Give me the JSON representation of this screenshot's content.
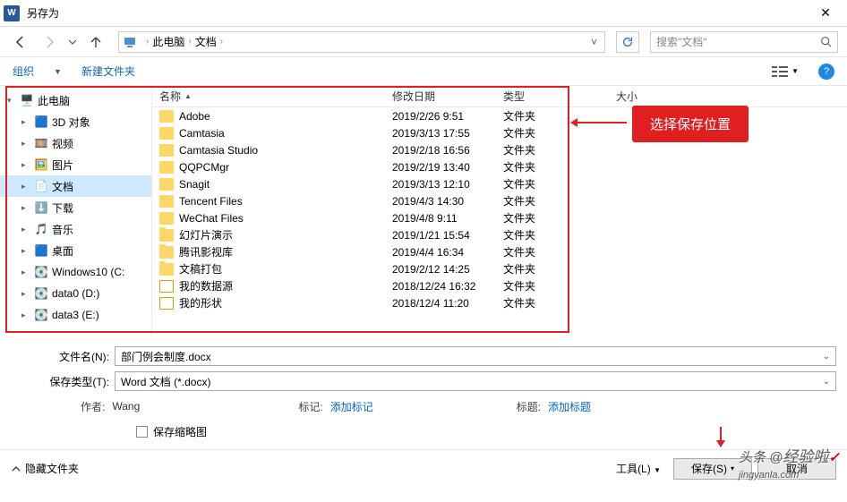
{
  "window": {
    "title": "另存为"
  },
  "nav": {
    "breadcrumb": [
      "此电脑",
      "文档"
    ],
    "search_placeholder": "搜索\"文档\""
  },
  "toolbar": {
    "organize": "组织",
    "newfolder": "新建文件夹"
  },
  "tree": [
    {
      "label": "此电脑",
      "exp": "▾",
      "icon": "pc"
    },
    {
      "label": "3D 对象",
      "exp": "▸",
      "icon": "3d",
      "indent": true
    },
    {
      "label": "视频",
      "exp": "▸",
      "icon": "video",
      "indent": true
    },
    {
      "label": "图片",
      "exp": "▸",
      "icon": "pic",
      "indent": true
    },
    {
      "label": "文档",
      "exp": "▸",
      "icon": "doc",
      "indent": true,
      "sel": true
    },
    {
      "label": "下载",
      "exp": "▸",
      "icon": "dl",
      "indent": true
    },
    {
      "label": "音乐",
      "exp": "▸",
      "icon": "music",
      "indent": true
    },
    {
      "label": "桌面",
      "exp": "▸",
      "icon": "desk",
      "indent": true
    },
    {
      "label": "Windows10 (C:",
      "exp": "▸",
      "icon": "drive",
      "indent": true
    },
    {
      "label": "data0 (D:)",
      "exp": "▸",
      "icon": "drive",
      "indent": true
    },
    {
      "label": "data3 (E:)",
      "exp": "▸",
      "icon": "drive",
      "indent": true
    }
  ],
  "columns": {
    "name": "名称",
    "date": "修改日期",
    "type": "类型",
    "size": "大小"
  },
  "files": [
    {
      "name": "Adobe",
      "date": "2019/2/26 9:51",
      "type": "文件夹",
      "icon": "folder"
    },
    {
      "name": "Camtasia",
      "date": "2019/3/13 17:55",
      "type": "文件夹",
      "icon": "folder"
    },
    {
      "name": "Camtasia Studio",
      "date": "2019/2/18 16:56",
      "type": "文件夹",
      "icon": "folder"
    },
    {
      "name": "QQPCMgr",
      "date": "2019/2/19 13:40",
      "type": "文件夹",
      "icon": "folder"
    },
    {
      "name": "Snagit",
      "date": "2019/3/13 12:10",
      "type": "文件夹",
      "icon": "folder"
    },
    {
      "name": "Tencent Files",
      "date": "2019/4/3 14:30",
      "type": "文件夹",
      "icon": "folder"
    },
    {
      "name": "WeChat Files",
      "date": "2019/4/8 9:11",
      "type": "文件夹",
      "icon": "folder"
    },
    {
      "name": "幻灯片演示",
      "date": "2019/1/21 15:54",
      "type": "文件夹",
      "icon": "folder"
    },
    {
      "name": "腾讯影视库",
      "date": "2019/4/4 16:34",
      "type": "文件夹",
      "icon": "folder"
    },
    {
      "name": "文稿打包",
      "date": "2019/2/12 14:25",
      "type": "文件夹",
      "icon": "folder"
    },
    {
      "name": "我的数据源",
      "date": "2018/12/24 16:32",
      "type": "文件夹",
      "icon": "db"
    },
    {
      "name": "我的形状",
      "date": "2018/12/4 11:20",
      "type": "文件夹",
      "icon": "db"
    }
  ],
  "form": {
    "filename_label": "文件名(N):",
    "filename_value": "部门例会制度.docx",
    "filetype_label": "保存类型(T):",
    "filetype_value": "Word 文档 (*.docx)",
    "author_label": "作者:",
    "author_value": "Wang",
    "tag_label": "标记:",
    "tag_value": "添加标记",
    "title_label": "标题:",
    "title_value": "添加标题",
    "thumb_label": "保存缩略图"
  },
  "footer": {
    "hide": "隐藏文件夹",
    "tools": "工具(L)",
    "save": "保存(S)",
    "cancel": "取消",
    "watermark1": "头条 @",
    "watermark2": "jingyanla.com"
  },
  "annot": {
    "label": "选择保存位置"
  },
  "icons": {
    "pc": "🖥️",
    "3d": "🟦",
    "video": "🎞️",
    "pic": "🖼️",
    "doc": "📄",
    "dl": "⬇️",
    "music": "🎵",
    "desk": "🟦",
    "drive": "💽"
  }
}
